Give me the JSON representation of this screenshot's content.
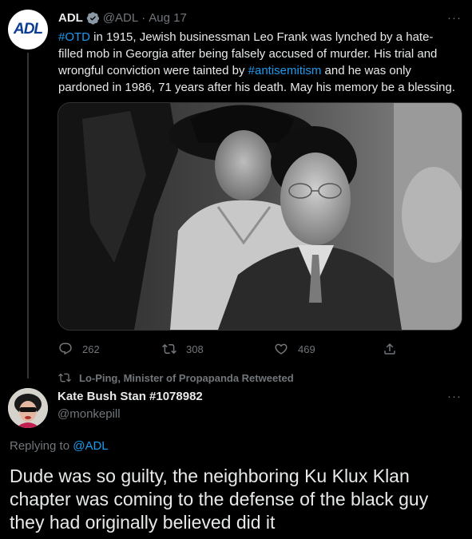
{
  "tweet": {
    "avatar_text": "ADL",
    "author_name": "ADL",
    "handle": "@ADL",
    "separator": "·",
    "date": "Aug 17",
    "more_label": "···",
    "text_parts": {
      "hashtag1": "#OTD",
      "part1": " in 1915, Jewish businessman Leo Frank was lynched by a hate-filled mob in Georgia after being falsely accused of murder. His trial and wrongful conviction were tainted by ",
      "hashtag2": "#antisemitism",
      "part2": " and he was only pardoned in 1986, 71 years after his death. May his memory be a blessing."
    },
    "actions": {
      "replies": "262",
      "retweets": "308",
      "likes": "469"
    },
    "icons": [
      "reply-icon",
      "retweet-icon",
      "like-icon",
      "share-icon",
      "verified-icon"
    ]
  },
  "retweet_notice": {
    "text": "Lo-Ping, Minister of Propapanda Retweeted"
  },
  "reply": {
    "author_name": "Kate Bush Stan #1078982",
    "handle": "@monkepill",
    "more_label": "···",
    "replying_prefix": "Replying to ",
    "replying_to": "@ADL",
    "text": "Dude was so guilty, the neighboring Ku Klux Klan chapter was coming to the defense of the black guy they had originally believed did it"
  },
  "colors": {
    "background": "#000000",
    "text": "#e7e9ea",
    "muted": "#71767b",
    "link": "#1d9bf0"
  }
}
